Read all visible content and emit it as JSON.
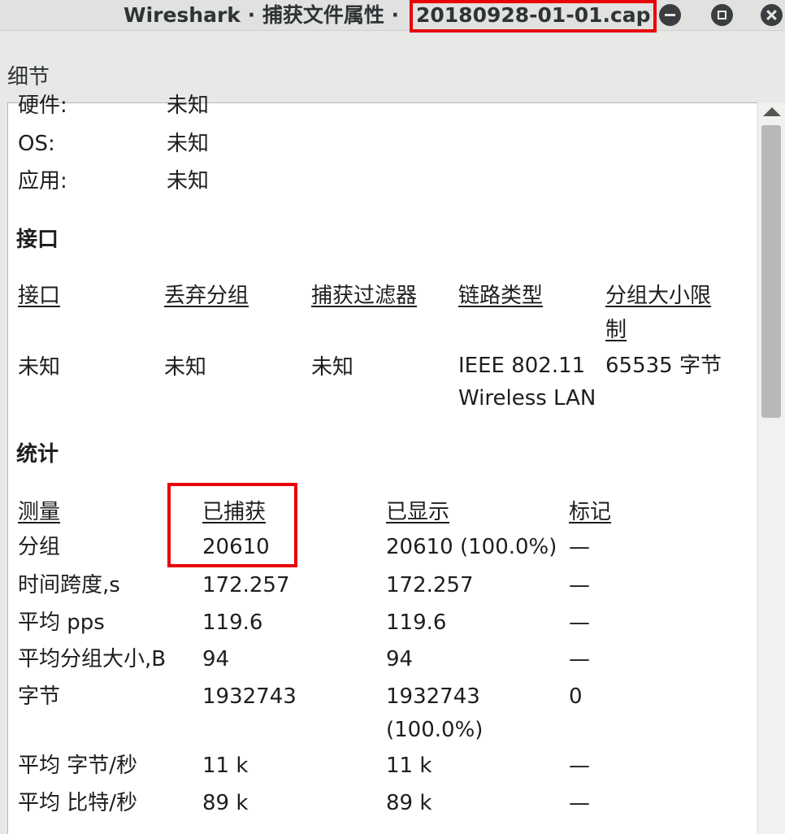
{
  "window": {
    "title_main": "Wireshark · 捕获文件属性 ·",
    "title_file": "20180928-01-01.cap"
  },
  "section_label": "细节",
  "capture_info": [
    {
      "label": "硬件:",
      "value": "未知"
    },
    {
      "label": "OS:",
      "value": "未知"
    },
    {
      "label": "应用:",
      "value": "未知"
    }
  ],
  "interfaces": {
    "heading": "接口",
    "columns": [
      "接口",
      "丢弃分组",
      "捕获过滤器",
      "链路类型",
      "分组大小限",
      "制"
    ],
    "row": {
      "interface": "未知",
      "dropped": "未知",
      "filter": "未知",
      "link_type_1": "IEEE 802.11",
      "link_type_2": "Wireless LAN",
      "snaplen": "65535 字节"
    }
  },
  "statistics": {
    "heading": "统计",
    "columns": [
      "测量",
      "已捕获",
      "已显示",
      "标记"
    ],
    "rows": [
      {
        "measure": "分组",
        "captured": "20610",
        "displayed": "20610 (100.0%)",
        "displayed_2": "",
        "marked": "—"
      },
      {
        "measure": "时间跨度,s",
        "captured": "172.257",
        "displayed": "172.257",
        "displayed_2": "",
        "marked": "—"
      },
      {
        "measure": "平均 pps",
        "captured": "119.6",
        "displayed": "119.6",
        "displayed_2": "",
        "marked": "—"
      },
      {
        "measure": "平均分组大小,B",
        "captured": "94",
        "displayed": "94",
        "displayed_2": "",
        "marked": "—"
      },
      {
        "measure": "字节",
        "captured": "1932743",
        "displayed": "1932743",
        "displayed_2": "(100.0%)",
        "marked": "0"
      },
      {
        "measure": "平均 字节/秒",
        "captured": "11 k",
        "displayed": "11 k",
        "displayed_2": "",
        "marked": "—"
      },
      {
        "measure": "平均 比特/秒",
        "captured": "89 k",
        "displayed": "89 k",
        "displayed_2": "",
        "marked": "—"
      }
    ]
  },
  "colors": {
    "highlight": "#e8000b",
    "titlebar": "#e1e1df",
    "panel": "#ffffff"
  }
}
